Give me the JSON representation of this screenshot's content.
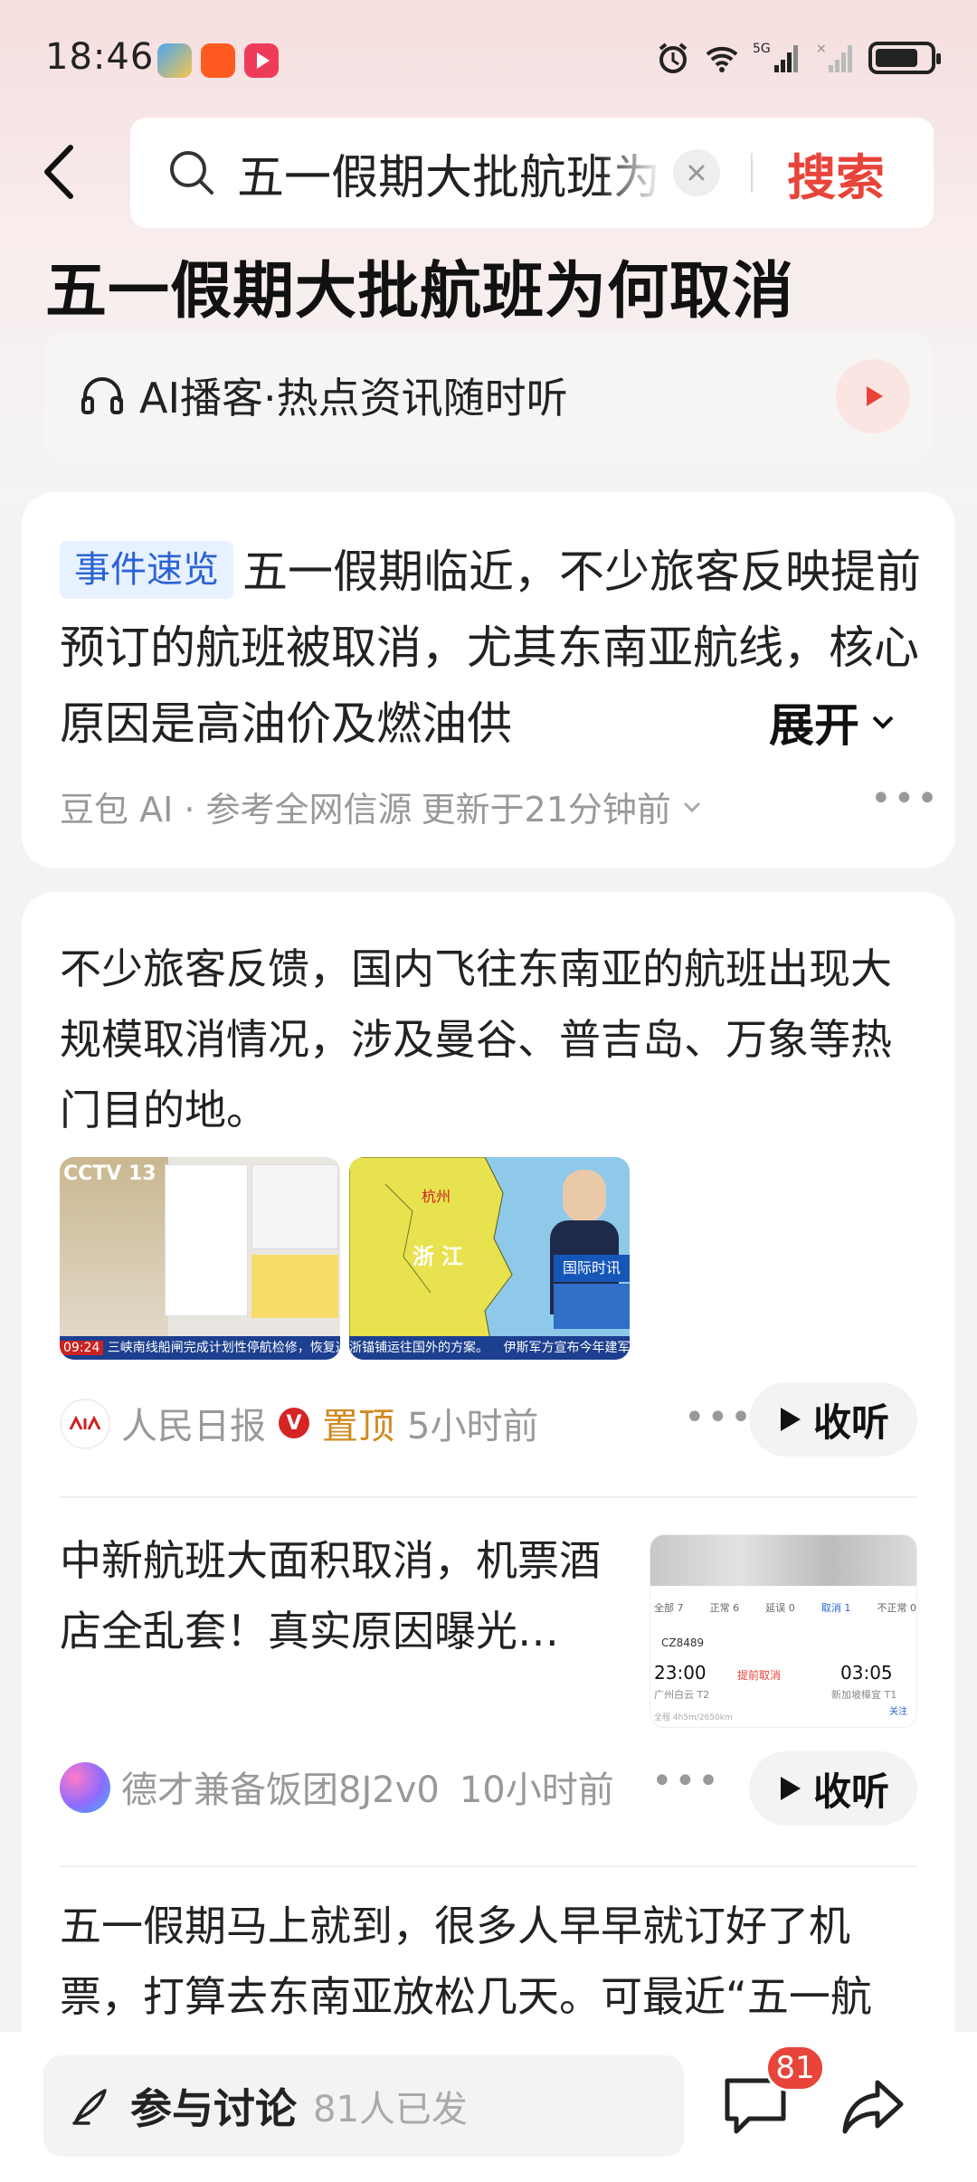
{
  "status_bar": {
    "time": "18:46",
    "network": "5G"
  },
  "header": {
    "search_query": "五一假期大批航班为何取消",
    "search_button": "搜索"
  },
  "page_title": "五一假期大批航班为何取消",
  "podcast": {
    "label": "AI播客·热点资讯随时听"
  },
  "ai_summary": {
    "tag": "事件速览",
    "text": "五一假期临近，不少旅客反映提前预订的航班被取消，尤其东南亚航线，核心原因是高油价及燃油供",
    "expand_label": "展开",
    "source": "豆包 AI · 参考全网信源",
    "updated": "更新于21分钟前"
  },
  "feed": {
    "items": [
      {
        "text": "不少旅客反馈，国内飞往东南亚的航班出现大规模取消情况，涉及曼谷、普吉岛、万象等热门目的地。",
        "thumb1": {
          "channel": "CCTV 13",
          "ticker": "三峡南线船闸完成计划性停航检修，恢复通航",
          "time": "09:24"
        },
        "thumb2": {
          "region": "浙江",
          "city": "杭州",
          "banner": "国际时讯",
          "ticker": "浙锚铺运往国外的方案。",
          "ticker2": "伊斯军方宣布今年建军节"
        },
        "source": "人民日报",
        "verified": "V",
        "pinned": "置顶",
        "time": "5小时前",
        "listen": "收听"
      },
      {
        "text": "中新航班大面积取消，机票酒店全乱套！真实原因曝光…",
        "thumb": {
          "tabs": [
            "全部 7",
            "正常 6",
            "延误 0",
            "取消 1",
            "不正常 0"
          ],
          "flight": "CZ8489",
          "dep_time": "23:00",
          "arr_time": "03:05",
          "status": "提前取消",
          "dep_airport": "广州白云 T2",
          "arr_airport": "新加坡樟宜 T1",
          "info": "全程 4h5m/2650km",
          "follow": "关注"
        },
        "source": "德才兼备饭团8J2v0",
        "time": "10小时前",
        "listen": "收听"
      },
      {
        "text": "五一假期马上就到，很多人早早就订好了机票，打算去东南亚放松几天。可最近“五一航"
      }
    ]
  },
  "bottom_bar": {
    "discuss_label": "参与讨论",
    "discuss_count": "81人已发",
    "comment_badge": "81"
  },
  "colors": {
    "accent": "#e8443a",
    "tag_blue": "#2a63d4",
    "pinned": "#d08a1f"
  }
}
